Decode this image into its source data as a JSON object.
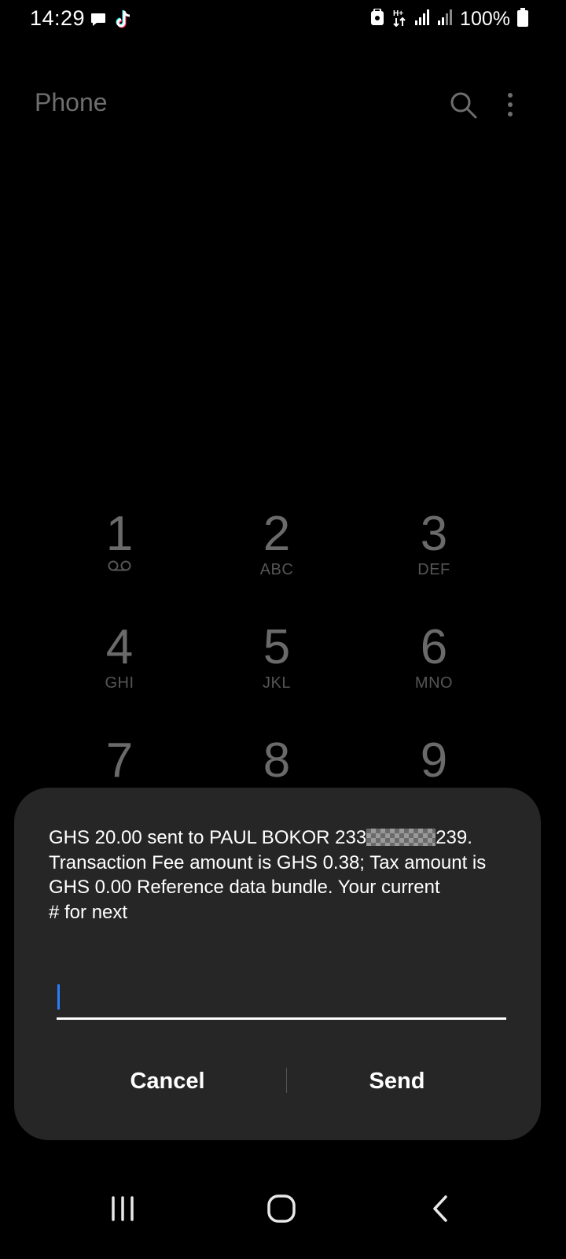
{
  "status_bar": {
    "time": "14:29",
    "left_icons": [
      "message-notification-icon",
      "tiktok-icon"
    ],
    "right_icons": [
      "lock-icon",
      "data-transfer-icon",
      "signal-icon",
      "signal-icon",
      "battery-icon"
    ],
    "battery_percent": "100%"
  },
  "header": {
    "title": "Phone",
    "search_icon": "search-icon",
    "more_icon": "more-options-icon"
  },
  "dialpad": {
    "keys": [
      {
        "digit": "1",
        "letters": ""
      },
      {
        "digit": "2",
        "letters": "ABC"
      },
      {
        "digit": "3",
        "letters": "DEF"
      },
      {
        "digit": "4",
        "letters": "GHI"
      },
      {
        "digit": "5",
        "letters": "JKL"
      },
      {
        "digit": "6",
        "letters": "MNO"
      },
      {
        "digit": "7",
        "letters": ""
      },
      {
        "digit": "8",
        "letters": ""
      },
      {
        "digit": "9",
        "letters": ""
      }
    ]
  },
  "dialog": {
    "message_part1": "GHS 20.00 sent to PAUL BOKOR 233",
    "message_part2": "239.\nTransaction Fee amount is GHS 0.38; Tax amount is GHS 0.00 Reference data bundle. Your current\n# for next",
    "input_value": "",
    "cancel_label": "Cancel",
    "send_label": "Send"
  },
  "nav_bar": {
    "recents_icon": "recents-icon",
    "home_icon": "home-icon",
    "back_icon": "back-icon"
  },
  "colors": {
    "background": "#000000",
    "dialog_bg": "#262626",
    "caret": "#2a7fff",
    "dim_text": "#6a6a6a"
  }
}
